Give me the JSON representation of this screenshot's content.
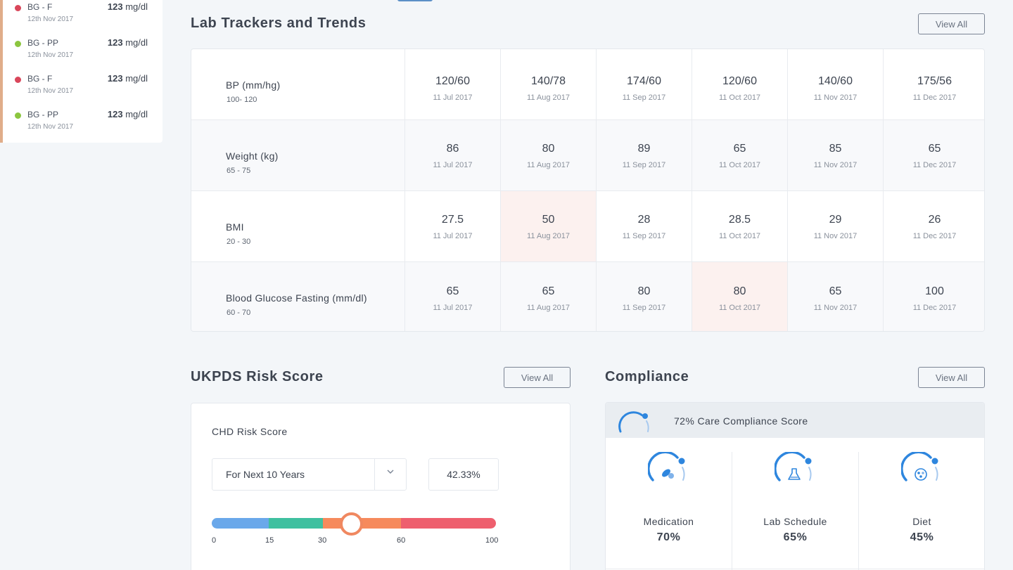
{
  "blood_glucose_list": [
    {
      "name": "BG - F",
      "date": "12th Nov 2017",
      "value": "123",
      "unit": "mg/dl",
      "status_color": "#d9465a"
    },
    {
      "name": "BG - PP",
      "date": "12th Nov 2017",
      "value": "123",
      "unit": "mg/dl",
      "status_color": "#8cc63f"
    },
    {
      "name": "BG - F",
      "date": "12th Nov 2017",
      "value": "123",
      "unit": "mg/dl",
      "status_color": "#d9465a"
    },
    {
      "name": "BG - PP",
      "date": "12th Nov 2017",
      "value": "123",
      "unit": "mg/dl",
      "status_color": "#8cc63f"
    }
  ],
  "lab_trackers": {
    "title": "Lab Trackers and Trends",
    "view_all_label": "View All",
    "rows": [
      {
        "name": "BP (mm/hg)",
        "range": "100- 120",
        "cells": [
          {
            "value": "120/60",
            "date": "11 Jul 2017",
            "flag": false
          },
          {
            "value": "140/78",
            "date": "11 Aug 2017",
            "flag": false
          },
          {
            "value": "174/60",
            "date": "11 Sep 2017",
            "flag": false
          },
          {
            "value": "120/60",
            "date": "11 Oct 2017",
            "flag": false
          },
          {
            "value": "140/60",
            "date": "11 Nov 2017",
            "flag": false
          },
          {
            "value": "175/56",
            "date": "11 Dec 2017",
            "flag": false
          }
        ]
      },
      {
        "name": "Weight (kg)",
        "range": "65 - 75",
        "cells": [
          {
            "value": "86",
            "date": "11 Jul 2017",
            "flag": false
          },
          {
            "value": "80",
            "date": "11 Aug 2017",
            "flag": false
          },
          {
            "value": "89",
            "date": "11 Sep 2017",
            "flag": false
          },
          {
            "value": "65",
            "date": "11 Oct 2017",
            "flag": false
          },
          {
            "value": "85",
            "date": "11 Nov 2017",
            "flag": false
          },
          {
            "value": "65",
            "date": "11 Dec 2017",
            "flag": false
          }
        ]
      },
      {
        "name": "BMI",
        "range": "20 - 30",
        "cells": [
          {
            "value": "27.5",
            "date": "11 Jul 2017",
            "flag": false
          },
          {
            "value": "50",
            "date": "11 Aug 2017",
            "flag": true
          },
          {
            "value": "28",
            "date": "11 Sep 2017",
            "flag": false
          },
          {
            "value": "28.5",
            "date": "11 Oct 2017",
            "flag": false
          },
          {
            "value": "29",
            "date": "11 Nov 2017",
            "flag": false
          },
          {
            "value": "26",
            "date": "11 Dec 2017",
            "flag": false
          }
        ]
      },
      {
        "name": "Blood Glucose Fasting (mm/dl)",
        "range": "60 - 70",
        "cells": [
          {
            "value": "65",
            "date": "11 Jul 2017",
            "flag": false
          },
          {
            "value": "65",
            "date": "11 Aug 2017",
            "flag": false
          },
          {
            "value": "80",
            "date": "11 Sep 2017",
            "flag": false
          },
          {
            "value": "80",
            "date": "11 Oct 2017",
            "flag": true
          },
          {
            "value": "65",
            "date": "11 Nov 2017",
            "flag": false
          },
          {
            "value": "100",
            "date": "11 Dec 2017",
            "flag": false
          }
        ]
      }
    ]
  },
  "ukpds": {
    "title": "UKPDS Risk Score",
    "view_all_label": "View All",
    "chd_label": "CHD Risk Score",
    "period_select": "For Next 10 Years",
    "score": "42.33%",
    "scale_ticks": [
      "0",
      "15",
      "30",
      "60",
      "100"
    ],
    "slider_value": 42.33,
    "segment_colors": [
      "#6aa8ea",
      "#3fc0a0",
      "#f68a5c",
      "#ee5f6e"
    ]
  },
  "compliance": {
    "title": "Compliance",
    "view_all_label": "View All",
    "header_text": "72% Care Compliance Score",
    "overall_percent": 72,
    "accent_color": "#2e86de",
    "items": [
      {
        "name": "Medication",
        "percent": "70%",
        "icon": "pills-icon"
      },
      {
        "name": "Lab Schedule",
        "percent": "65%",
        "icon": "flask-icon"
      },
      {
        "name": "Diet",
        "percent": "45%",
        "icon": "plate-icon"
      }
    ]
  }
}
